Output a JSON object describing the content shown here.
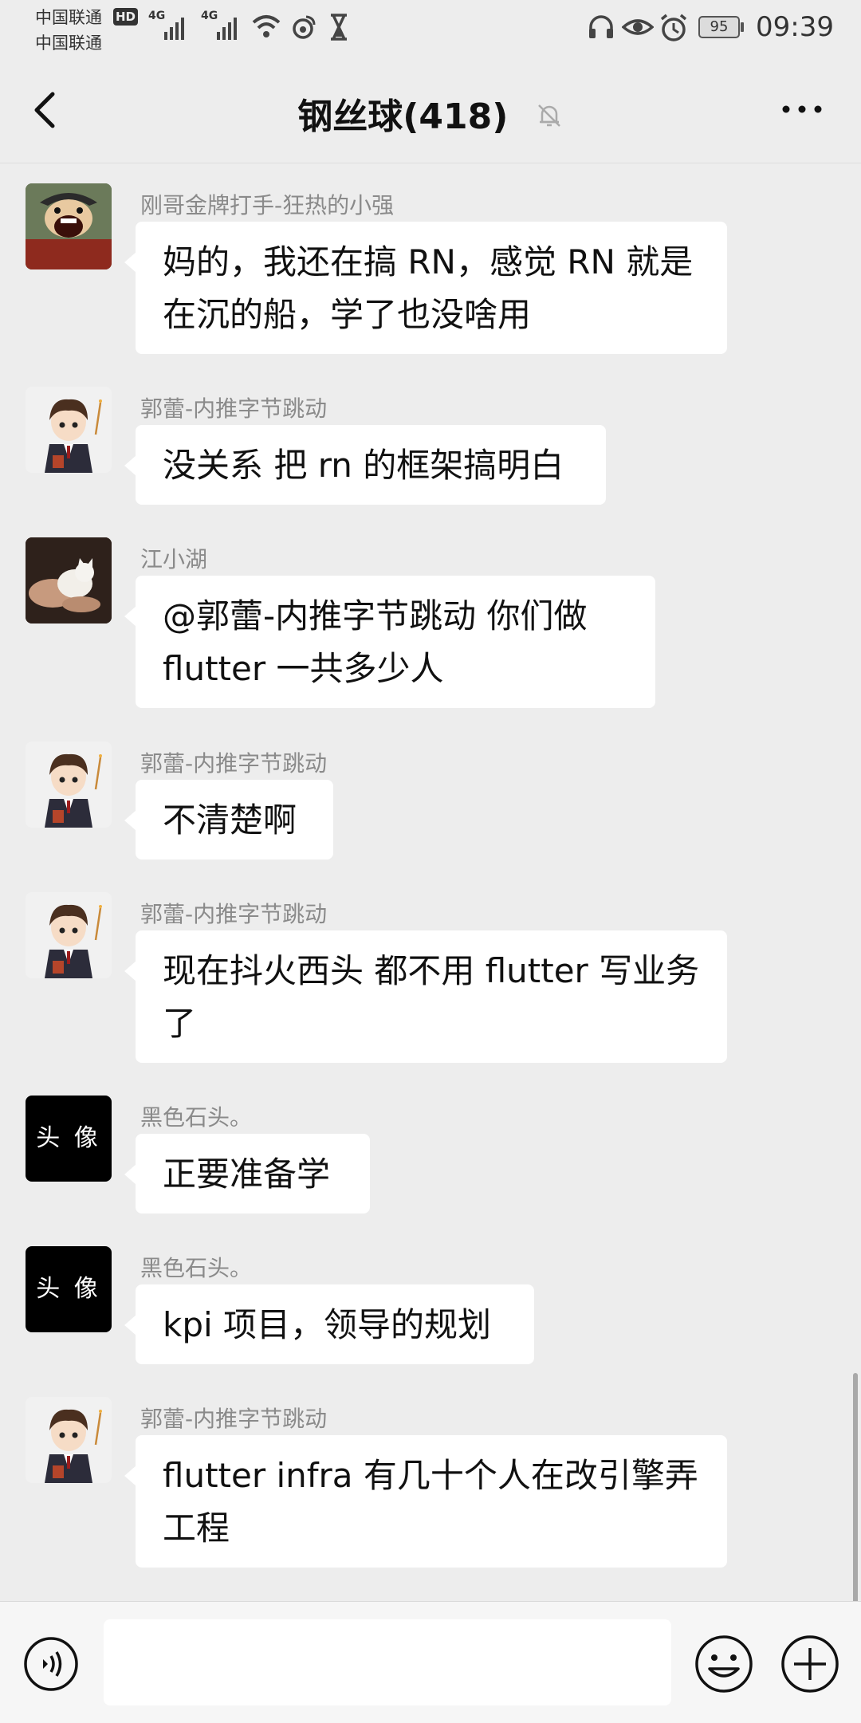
{
  "status_bar": {
    "carrier_1": "中国联通",
    "carrier_2": "中国联通",
    "hd": "HD",
    "net_1": "4G",
    "net_2": "4G",
    "battery": "95",
    "time": "09:39"
  },
  "nav": {
    "title": "钢丝球(418)"
  },
  "messages": [
    {
      "sender": "刚哥金牌打手-狂热的小强",
      "text": "妈的，我还在搞 RN，感觉 RN 就是在沉的船，学了也没啥用",
      "avatar": "cartoon-pirate-avatar"
    },
    {
      "sender": "郭蕾-内推字节跳动",
      "text": "没关系 把 rn 的框架搞明白",
      "avatar": "cartoon-boy-avatar"
    },
    {
      "sender": "江小湖",
      "text": "@郭蕾-内推字节跳动  你们做 flutter 一共多少人",
      "avatar": "cat-photo-avatar"
    },
    {
      "sender": "郭蕾-内推字节跳动",
      "text": "不清楚啊",
      "avatar": "cartoon-boy-avatar"
    },
    {
      "sender": "郭蕾-内推字节跳动",
      "text": "现在抖火西头 都不用 flutter 写业务了",
      "avatar": "cartoon-boy-avatar"
    },
    {
      "sender": "黑色石头。",
      "text": "正要准备学",
      "avatar": "black-text-avatar",
      "avatar_text": "头 像"
    },
    {
      "sender": "黑色石头。",
      "text": "kpi 项目，领导的规划",
      "avatar": "black-text-avatar",
      "avatar_text": "头 像"
    },
    {
      "sender": "郭蕾-内推字节跳动",
      "text": "flutter infra 有几十个人在改引擎弄工程",
      "avatar": "cartoon-boy-avatar"
    }
  ],
  "input": {
    "value": ""
  },
  "colors": {
    "background": "#ededed",
    "bubble": "#ffffff",
    "sender_text": "#8a8a8a"
  }
}
